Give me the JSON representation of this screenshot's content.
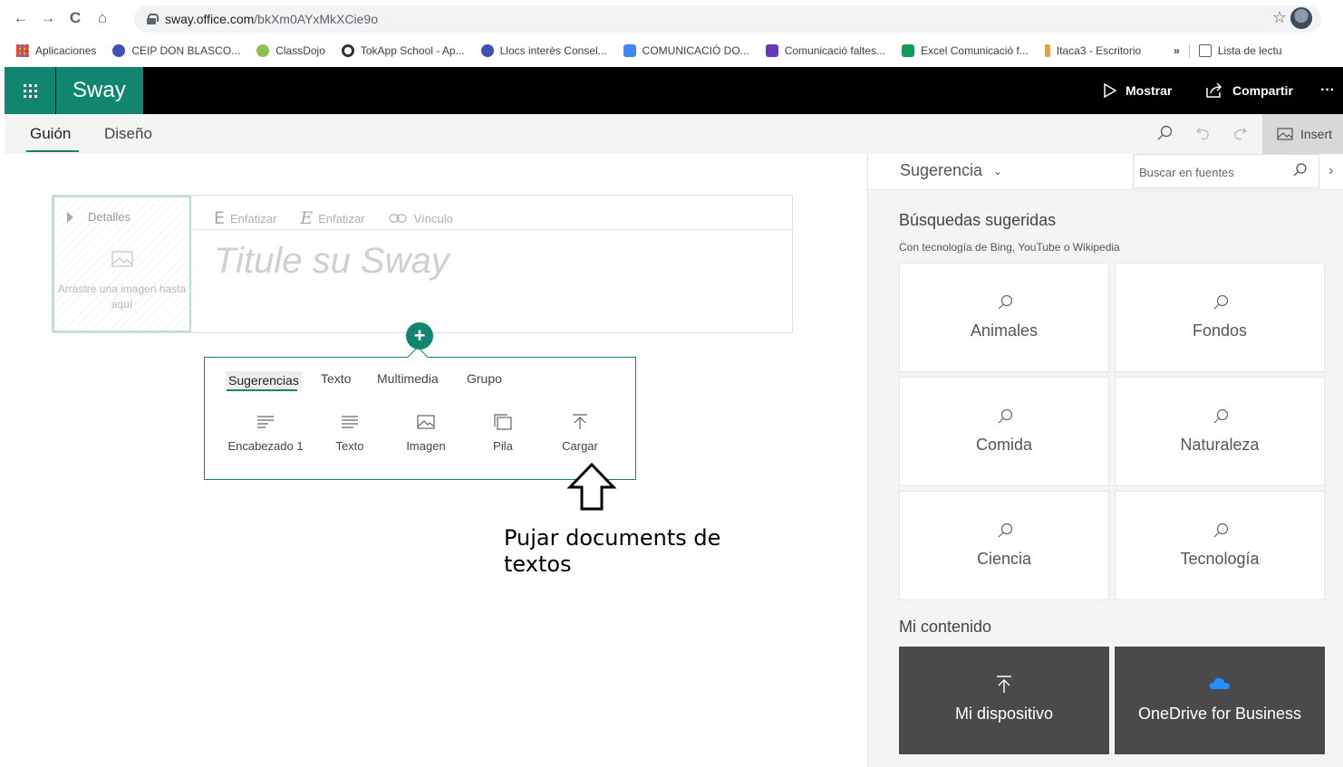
{
  "browser": {
    "url_domain": "sway.office.com",
    "url_path": "/bkXm0AYxMkXCie9o",
    "bookmarks": [
      {
        "label": "Aplicaciones",
        "color": "#1a73e8"
      },
      {
        "label": "CEIP DON BLASCO...",
        "color": "#3f51b5"
      },
      {
        "label": "ClassDojo",
        "color": "#4caf50"
      },
      {
        "label": "TokApp School - Ap...",
        "color": "#333333"
      },
      {
        "label": "Llocs interès Consel...",
        "color": "#3f51b5"
      },
      {
        "label": "COMUNICACIÓ DO...",
        "color": "#4285f4"
      },
      {
        "label": "Comunicació faltes...",
        "color": "#673ab7"
      },
      {
        "label": "Excel Comunicació f...",
        "color": "#0f9d58"
      },
      {
        "label": "Itaca3 - Escritorio",
        "color": "#e6a23c"
      }
    ],
    "more_bookmarks": "»",
    "reading_list": "Lista de lectu"
  },
  "app": {
    "brand": "Sway",
    "show_label": "Mostrar",
    "share_label": "Compartir",
    "more": "···",
    "accent_color": "#128570"
  },
  "toolbar": {
    "tab_script": "Guión",
    "tab_design": "Diseño",
    "insert_label": "Insert"
  },
  "title_card": {
    "details_label": "Detalles",
    "drag_hint": "Arrastre una imagen hasta aquí",
    "emphasis_1": "Enfatizar",
    "emphasis_2": "Enfatizar",
    "link": "Vínculo",
    "title_placeholder": "Titule su Sway"
  },
  "insert_panel": {
    "tabs": [
      "Sugerencias",
      "Texto",
      "Multimedia",
      "Grupo"
    ],
    "items": [
      "Encabezado 1",
      "Texto",
      "Imagen",
      "Pila",
      "Cargar"
    ]
  },
  "annotation": {
    "line1": "Pujar documents de",
    "line2": "textos"
  },
  "pane": {
    "dropdown": "Sugerencia",
    "search_placeholder": "Buscar en fuentes",
    "suggested_title": "Búsquedas sugeridas",
    "suggested_sub": "Con tecnología de Bing, YouTube o Wikipedia",
    "cards": [
      "Animales",
      "Fondos",
      "Comida",
      "Naturaleza",
      "Ciencia",
      "Tecnología"
    ],
    "my_content_title": "Mi contenido",
    "my_device": "Mi dispositivo",
    "onedrive": "OneDrive for Business"
  }
}
